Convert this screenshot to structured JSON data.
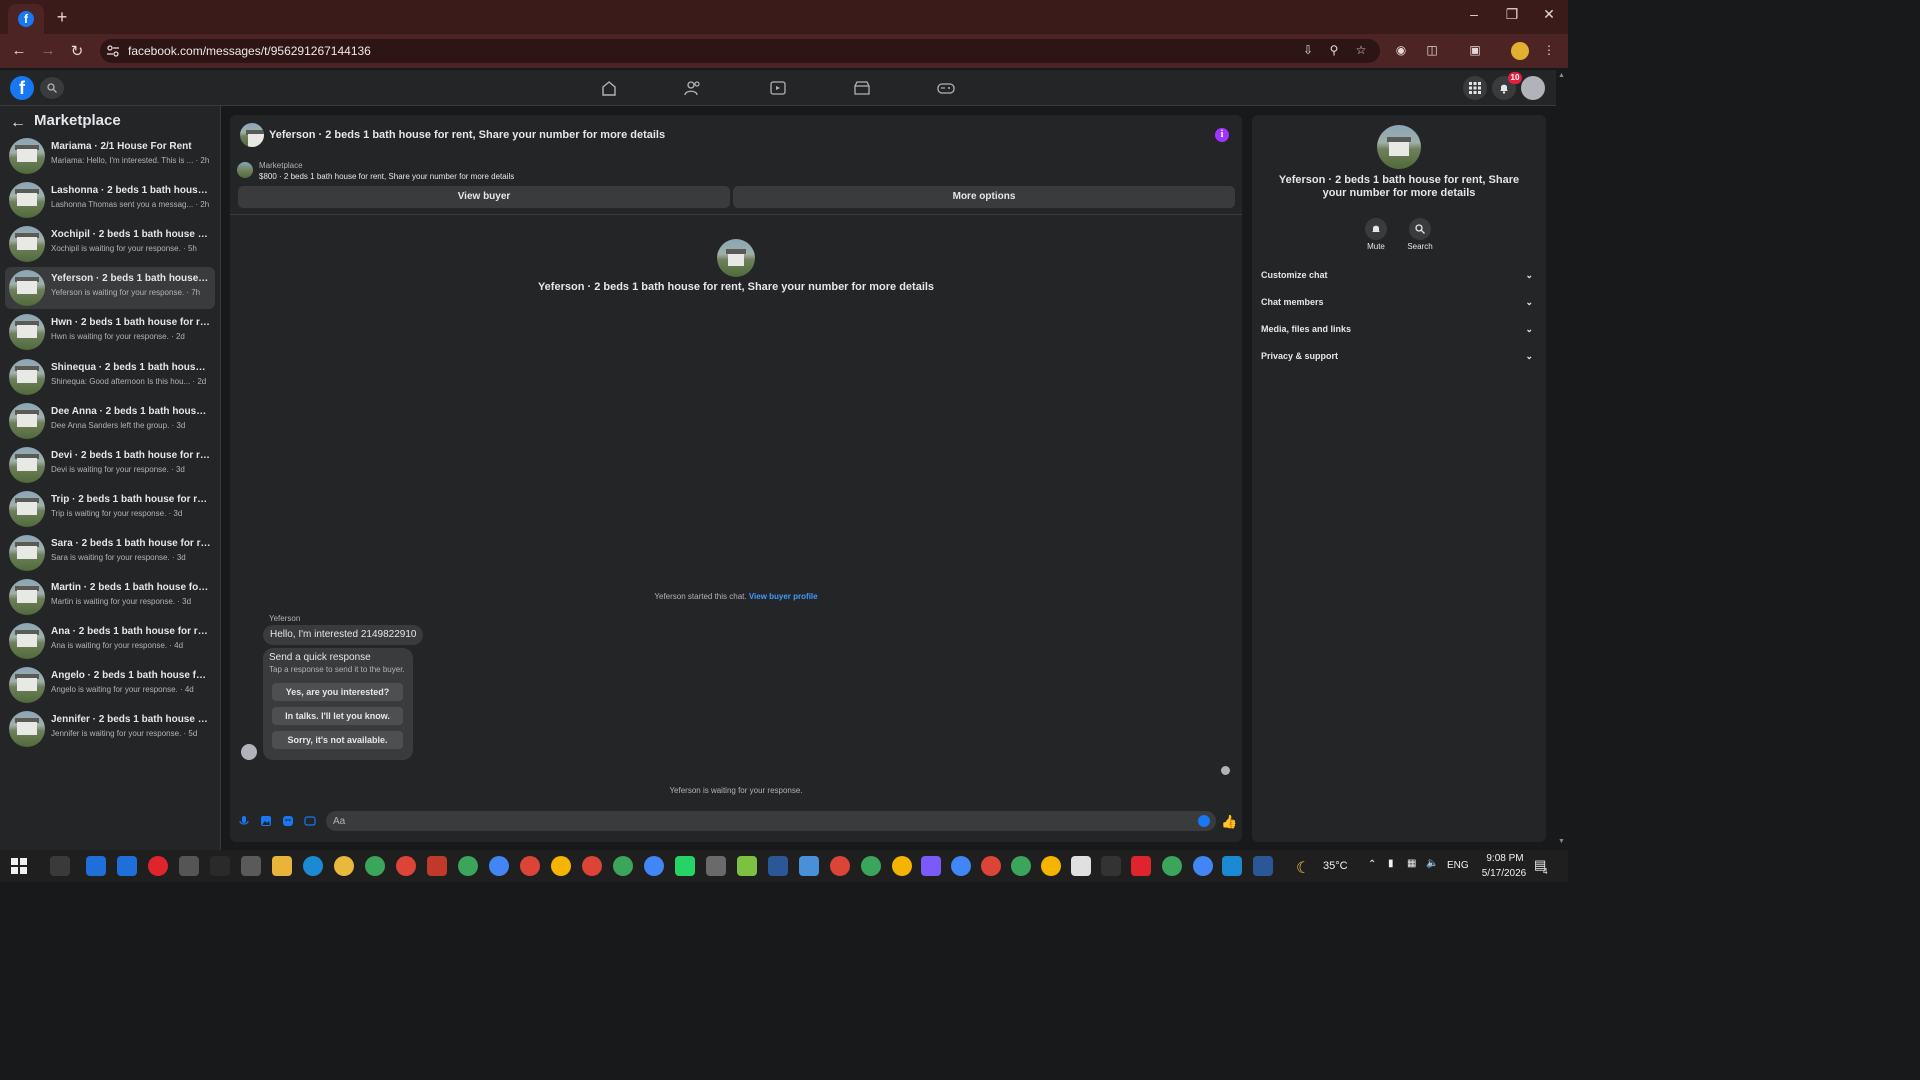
{
  "browser": {
    "url": "facebook.com/messages/t/956291267144136",
    "tab_favicon": "f",
    "new_tab_label": "+",
    "window_controls": {
      "minimize": "–",
      "maximize": "❐",
      "close": "✕"
    }
  },
  "fb_nav": {
    "logo": "f",
    "notification_count": "10"
  },
  "sidebar": {
    "title": "Marketplace",
    "conversations": [
      {
        "name": "Mariama · 2/1 House For Rent",
        "preview": "Mariama: Hello, I'm interested. This is ... · 2h"
      },
      {
        "name": "Lashonna · 2 beds 1 bath house for...",
        "preview": "Lashonna Thomas sent you a messag... · 2h"
      },
      {
        "name": "Xochipil · 2 beds 1 bath house for r...",
        "preview": "Xochipil is waiting for your response. · 5h"
      },
      {
        "name": "Yeferson · 2 beds 1 bath house for ...",
        "preview": "Yeferson is waiting for your response. · 7h"
      },
      {
        "name": "Hwn · 2 beds 1 bath house for rent...",
        "preview": "Hwn is waiting for your response. · 2d"
      },
      {
        "name": "Shinequa · 2 beds 1 bath house for...",
        "preview": "Shinequa: Good afternoon Is this hou... · 2d"
      },
      {
        "name": "Dee Anna · 2 beds 1 bath house fo...",
        "preview": "Dee Anna Sanders left the group. · 3d"
      },
      {
        "name": "Devi · 2 beds 1 bath house for rent...",
        "preview": "Devi is waiting for your response. · 3d"
      },
      {
        "name": "Trip · 2 beds 1 bath house for rent, ...",
        "preview": "Trip is waiting for your response. · 3d"
      },
      {
        "name": "Sara · 2 beds 1 bath house for rent,...",
        "preview": "Sara is waiting for your response. · 3d"
      },
      {
        "name": "Martin · 2 beds 1 bath house for re...",
        "preview": "Martin is waiting for your response. · 3d"
      },
      {
        "name": "Ana · 2 beds 1 bath house for rent,...",
        "preview": "Ana is waiting for your response. · 4d"
      },
      {
        "name": "Angelo · 2 beds 1 bath house for r...",
        "preview": "Angelo is waiting for your response. · 4d"
      },
      {
        "name": "Jennifer · 2 beds 1 bath house for r...",
        "preview": "Jennifer is waiting for your response. · 5d"
      }
    ]
  },
  "chat": {
    "title": "Yeferson · 2 beds 1 bath house for rent, Share your number for more details",
    "marketplace_label": "Marketplace",
    "listing": "$800 · 2 beds 1 bath house for rent, Share your number for more details",
    "view_buyer": "View buyer",
    "more_options": "More options",
    "center_title": "Yeferson · 2 beds 1 bath house for rent, Share your number for more details",
    "started_text": "Yeferson started this chat.",
    "view_buyer_profile": "View buyer profile",
    "sender": "Yeferson",
    "message": "Hello, I'm interested 2149822910",
    "quick_title": "Send a quick response",
    "quick_sub": "Tap a response to send it to the buyer.",
    "quick_replies": [
      "Yes, are you interested?",
      "In talks. I'll let you know.",
      "Sorry, it's not available."
    ],
    "waiting": "Yeferson is waiting for your response.",
    "composer_placeholder": "Aa"
  },
  "right_panel": {
    "title": "Yeferson · 2 beds 1 bath house for rent, Share your number for more details",
    "mute": "Mute",
    "search": "Search",
    "sections": [
      "Customize chat",
      "Chat members",
      "Media, files and links",
      "Privacy & support"
    ]
  },
  "taskbar": {
    "temperature": "35°C",
    "language": "ENG",
    "time": "9:08 PM",
    "date": "5/17/2026",
    "notif_count": "4"
  },
  "colors": {
    "accent": "#1877f2",
    "info": "#a033ff",
    "link": "#4599ff",
    "badge": "#e41e3f",
    "browser_frame": "#4d2424"
  }
}
